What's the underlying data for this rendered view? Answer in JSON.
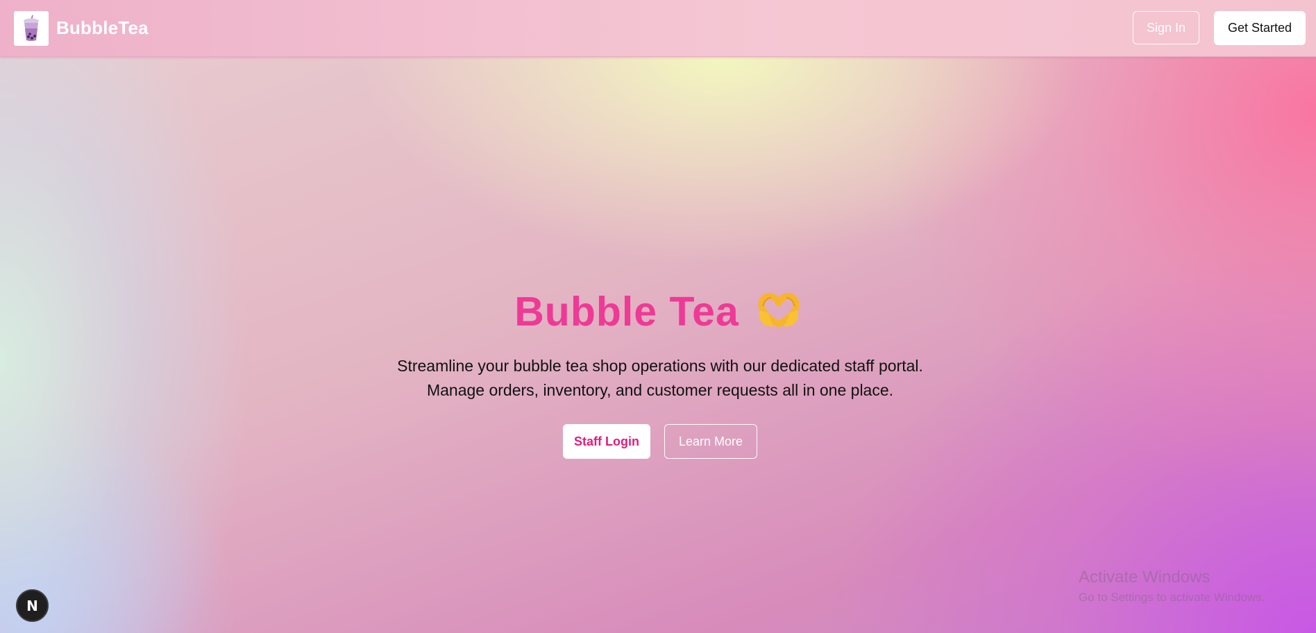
{
  "header": {
    "brand": "BubbleTea",
    "logo_icon": "bubble-tea-cup-icon",
    "sign_in_label": "Sign In",
    "get_started_label": "Get Started"
  },
  "hero": {
    "title": "Bubble Tea",
    "title_emoji": "🫶",
    "description": "Streamline your bubble tea shop operations with our dedicated staff portal. Manage orders, inventory, and customer requests all in one place.",
    "staff_login_label": "Staff Login",
    "learn_more_label": "Learn More"
  },
  "dev_badge": {
    "letter": "N"
  },
  "watermark": {
    "title": "Activate Windows",
    "subtitle": "Go to Settings to activate Windows."
  },
  "colors": {
    "title_pink": "#ee3a96",
    "staff_login_text": "#e21c7e",
    "header_pink": "#f2bfd0"
  }
}
